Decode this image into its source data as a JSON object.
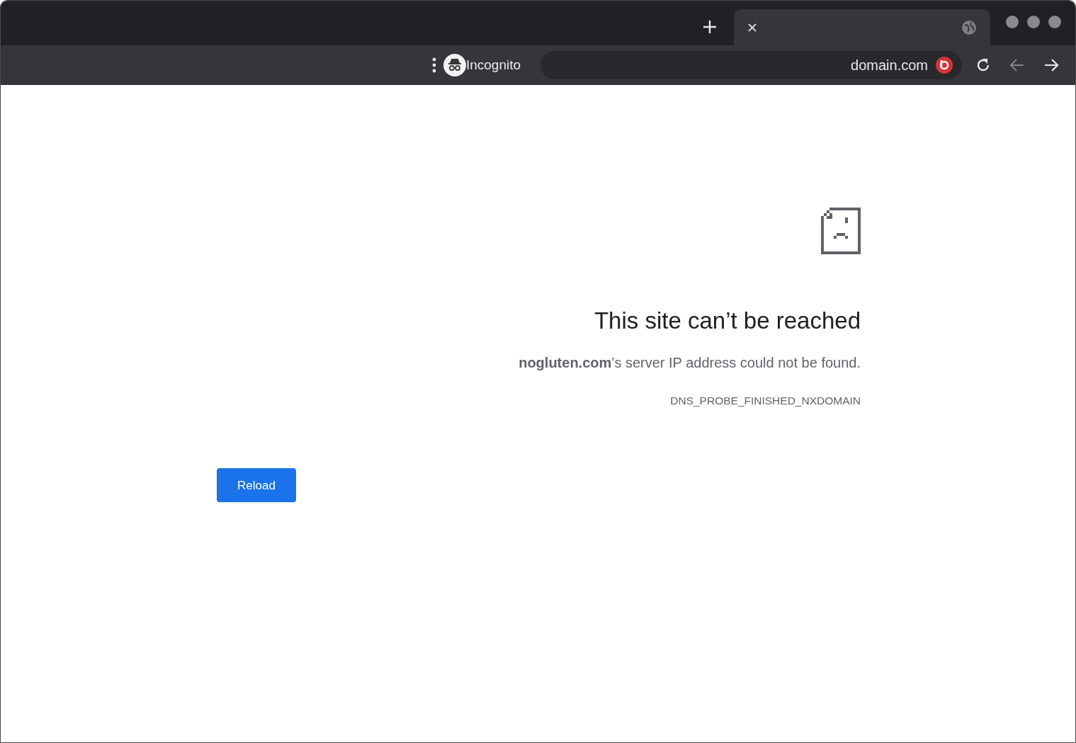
{
  "toolbar": {
    "nav_buttons": [
      {
        "kind": "forward",
        "disabled": false
      },
      {
        "kind": "back",
        "disabled": true
      },
      {
        "kind": "reload",
        "disabled": false
      }
    ],
    "address": "domain.com",
    "profile": "Incognito"
  },
  "error": {
    "heading": "This site can’t be reached",
    "message": "**nogluten.com**’s server IP address could not be found.",
    "code": "DNS_PROBE_FINISHED_NXDOMAIN",
    "button": "Reload"
  }
}
